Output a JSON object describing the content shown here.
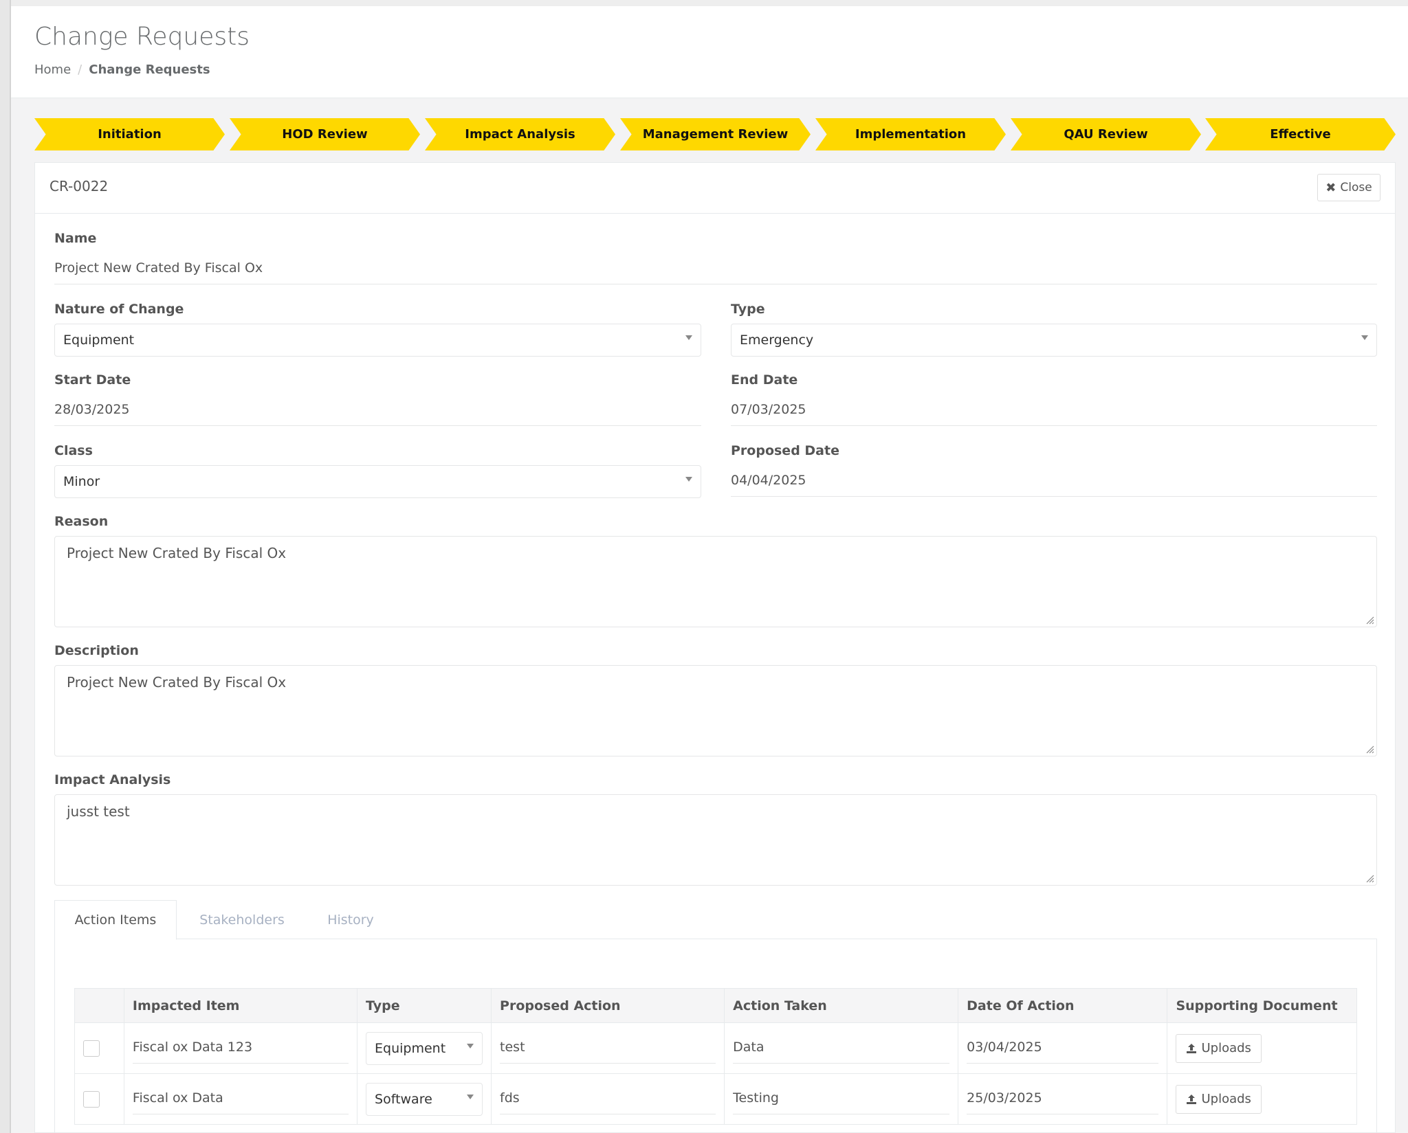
{
  "page": {
    "title": "Change Requests",
    "breadcrumb": {
      "home": "Home",
      "separator": "/",
      "current": "Change Requests"
    }
  },
  "workflow": {
    "color": "#fed800",
    "steps": [
      "Initiation",
      "HOD Review",
      "Impact Analysis",
      "Management Review",
      "Implementation",
      "QAU Review",
      "Effective"
    ]
  },
  "record": {
    "code": "CR-0022",
    "close_label": "Close",
    "close_icon": "times-icon"
  },
  "form": {
    "name": {
      "label": "Name",
      "value": "Project New Crated By Fiscal Ox"
    },
    "nature_of_change": {
      "label": "Nature of Change",
      "value": "Equipment"
    },
    "type": {
      "label": "Type",
      "value": "Emergency"
    },
    "start_date": {
      "label": "Start Date",
      "value": "28/03/2025"
    },
    "end_date": {
      "label": "End Date",
      "value": "07/03/2025"
    },
    "class": {
      "label": "Class",
      "value": "Minor"
    },
    "proposed_date": {
      "label": "Proposed Date",
      "value": "04/04/2025"
    },
    "reason": {
      "label": "Reason",
      "value": "Project New Crated By Fiscal Ox"
    },
    "description": {
      "label": "Description",
      "value": "Project New Crated By Fiscal Ox"
    },
    "impact_analysis": {
      "label": "Impact Analysis",
      "value": "jusst test"
    }
  },
  "tabs": [
    "Action Items",
    "Stakeholders",
    "History"
  ],
  "action_items": {
    "columns": [
      "Impacted Item",
      "Type",
      "Proposed Action",
      "Action Taken",
      "Date Of Action",
      "Supporting Document"
    ],
    "rows": [
      {
        "impacted_item": "Fiscal ox Data 123",
        "type": "Equipment",
        "proposed_action": "test",
        "action_taken": "Data",
        "date_of_action": "03/04/2025",
        "document": "Uploads"
      },
      {
        "impacted_item": "Fiscal ox Data",
        "type": "Software",
        "proposed_action": "fds",
        "action_taken": "Testing",
        "date_of_action": "25/03/2025",
        "document": "Uploads"
      }
    ]
  }
}
